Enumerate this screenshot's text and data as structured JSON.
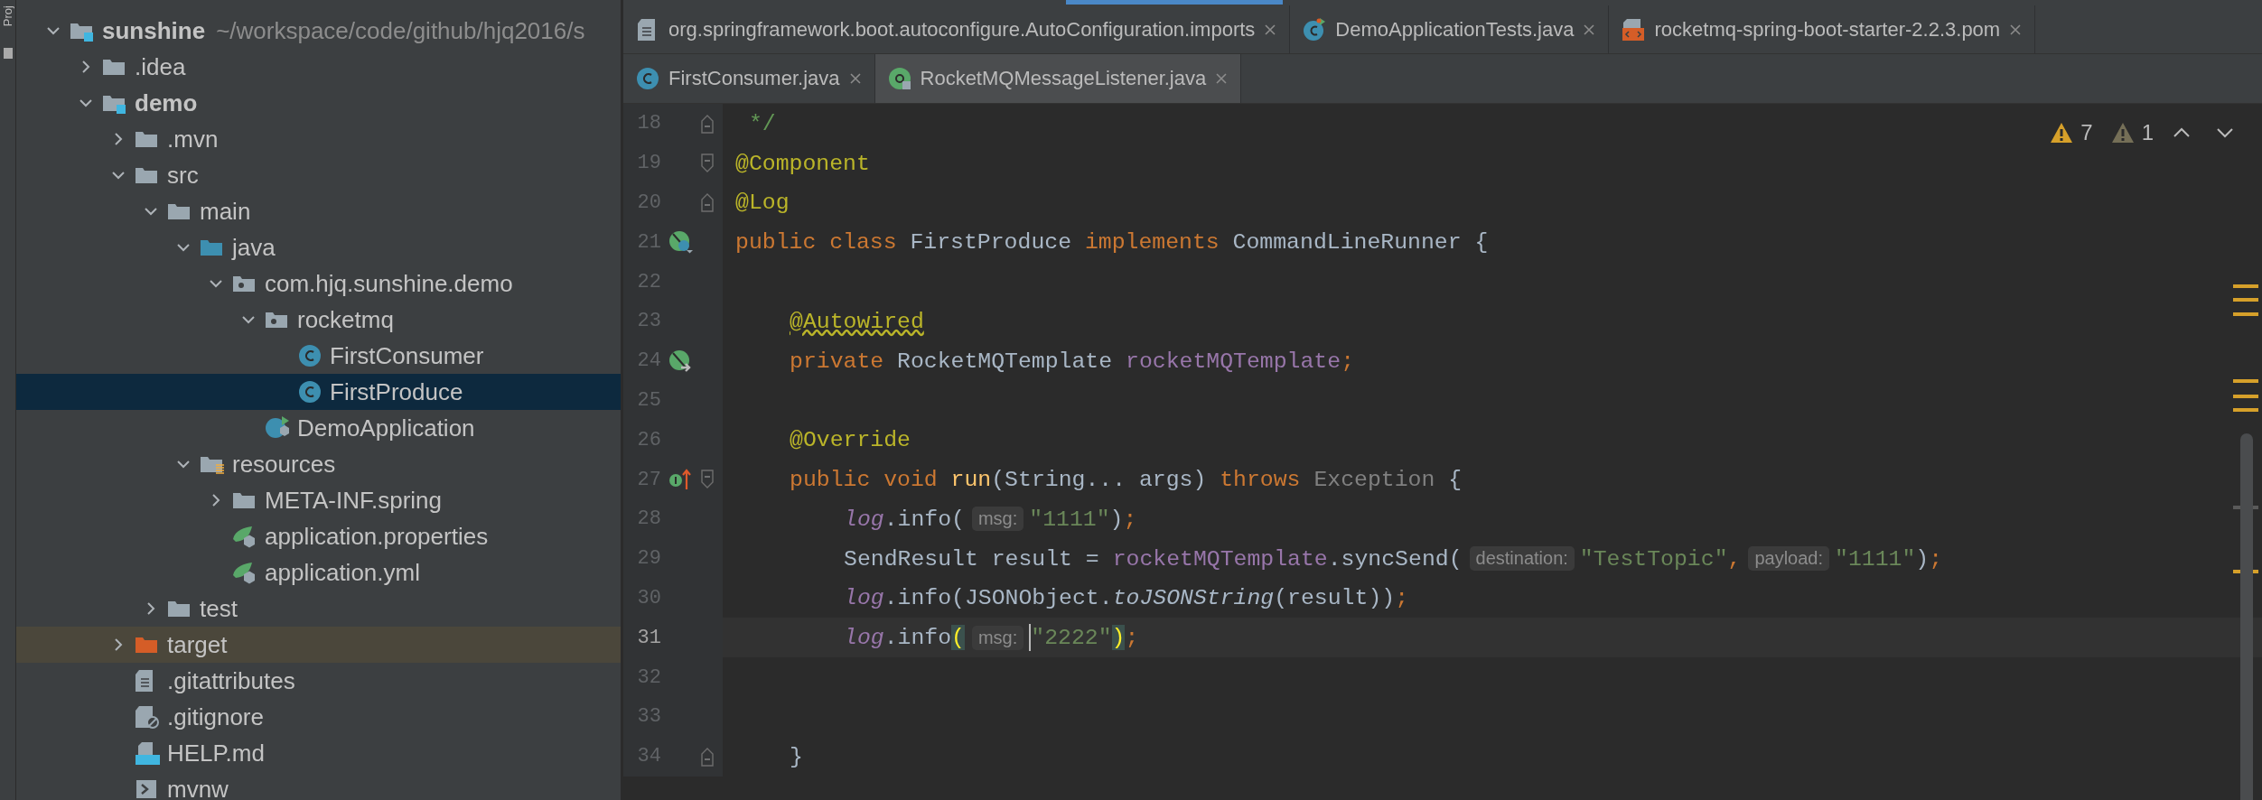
{
  "tool_window_strip": {
    "label": "Proj"
  },
  "tree": {
    "items": [
      {
        "label": "sunshine",
        "kind": "module",
        "path": "~/workspace/code/github/hjq2016/s",
        "expanded": true,
        "selected": false,
        "children": [
          {
            "label": ".idea",
            "kind": "folder",
            "expanded": false,
            "selected": false
          },
          {
            "label": "demo",
            "kind": "module",
            "expanded": true,
            "selected": false,
            "children": [
              {
                "label": ".mvn",
                "kind": "folder",
                "expanded": false,
                "selected": false
              },
              {
                "label": "src",
                "kind": "folder",
                "expanded": true,
                "selected": false,
                "children": [
                  {
                    "label": "main",
                    "kind": "folder",
                    "expanded": true,
                    "selected": false,
                    "children": [
                      {
                        "label": "java",
                        "kind": "source-folder",
                        "expanded": true,
                        "selected": false,
                        "children": [
                          {
                            "label": "com.hjq.sunshine.demo",
                            "kind": "package",
                            "expanded": true,
                            "selected": false,
                            "children": [
                              {
                                "label": "rocketmq",
                                "kind": "package",
                                "expanded": true,
                                "selected": false,
                                "children": [
                                  {
                                    "label": "FirstConsumer",
                                    "kind": "class",
                                    "selected": false
                                  },
                                  {
                                    "label": "FirstProduce",
                                    "kind": "class",
                                    "selected": true
                                  }
                                ]
                              },
                              {
                                "label": "DemoApplication",
                                "kind": "spring-class",
                                "selected": false
                              }
                            ]
                          }
                        ]
                      },
                      {
                        "label": "resources",
                        "kind": "resources-folder",
                        "expanded": true,
                        "selected": false,
                        "children": [
                          {
                            "label": "META-INF.spring",
                            "kind": "folder",
                            "expanded": false,
                            "selected": false
                          },
                          {
                            "label": "application.properties",
                            "kind": "spring-config",
                            "selected": false
                          },
                          {
                            "label": "application.yml",
                            "kind": "spring-config",
                            "selected": false
                          }
                        ]
                      }
                    ]
                  },
                  {
                    "label": "test",
                    "kind": "folder",
                    "expanded": false,
                    "selected": false
                  }
                ]
              },
              {
                "label": "target",
                "kind": "excluded-folder",
                "expanded": false,
                "selected": false
              },
              {
                "label": ".gitattributes",
                "kind": "text-file",
                "selected": false
              },
              {
                "label": ".gitignore",
                "kind": "ignore-file",
                "selected": false
              },
              {
                "label": "HELP.md",
                "kind": "markdown",
                "selected": false
              },
              {
                "label": "mvnw",
                "kind": "shell",
                "selected": false
              }
            ]
          }
        ]
      }
    ]
  },
  "tab_rows": [
    {
      "tabs": [
        {
          "label": "org.springframework.boot.autoconfigure.AutoConfiguration.imports",
          "kind": "text-file",
          "library": false,
          "selected": false
        },
        {
          "label": "DemoApplicationTests.java",
          "kind": "test-class",
          "library": false,
          "selected": false
        },
        {
          "label": "rocketmq-spring-boot-starter-2.2.3.pom",
          "kind": "pom",
          "library": false,
          "selected": false
        }
      ]
    },
    {
      "tabs": [
        {
          "label": "FirstConsumer.java",
          "kind": "class",
          "library": false,
          "selected": false
        },
        {
          "label": "RocketMQMessageListener.java",
          "kind": "annotation",
          "library": true,
          "selected": false
        }
      ]
    }
  ],
  "inspections": {
    "warnings": "7",
    "weak_warnings": "1"
  },
  "code_lines": [
    {
      "number": "18",
      "kind": "top",
      "fold_marker": {
        "kind": "end"
      },
      "current": false,
      "tokens": [
        {
          "kind": "comment",
          "text": " */"
        }
      ]
    },
    {
      "number": "19",
      "kind": "top",
      "fold_marker": {
        "kind": "start"
      },
      "current": false,
      "tokens": [
        {
          "kind": "annotation",
          "text": "@Component"
        }
      ]
    },
    {
      "number": "20",
      "kind": "top",
      "fold_marker": {
        "kind": "end"
      },
      "current": false,
      "tokens": [
        {
          "kind": "annotation",
          "text": "@Log"
        }
      ]
    },
    {
      "number": "21",
      "kind": "top",
      "gutter_icon": {
        "kind": "bean"
      },
      "current": false,
      "tokens": [
        {
          "kind": "keyword",
          "text": "public class "
        },
        {
          "kind": "plain",
          "text": "FirstProduce "
        },
        {
          "kind": "keyword",
          "text": "implements "
        },
        {
          "kind": "plain",
          "text": "CommandLineRunner {"
        }
      ]
    },
    {
      "number": "22",
      "kind": "top",
      "current": false
    },
    {
      "number": "23",
      "kind": "class",
      "current": false,
      "tokens": [
        {
          "kind": "warn-annotation",
          "text": "@Autowired"
        }
      ]
    },
    {
      "number": "24",
      "kind": "class",
      "gutter_icon": {
        "kind": "autowired"
      },
      "current": false,
      "tokens": [
        {
          "kind": "keyword",
          "text": "private "
        },
        {
          "kind": "plain",
          "text": "RocketMQTemplate "
        },
        {
          "kind": "field",
          "text": "rocketMQTemplate"
        },
        {
          "kind": "punct",
          "text": ";"
        }
      ]
    },
    {
      "number": "25",
      "kind": "top",
      "current": false
    },
    {
      "number": "26",
      "kind": "class",
      "current": false,
      "tokens": [
        {
          "kind": "annotation",
          "text": "@Override"
        }
      ]
    },
    {
      "number": "27",
      "kind": "class",
      "fold_marker": {
        "kind": "start"
      },
      "gutter_icon": {
        "kind": "override"
      },
      "current": false,
      "tokens": [
        {
          "kind": "keyword",
          "text": "public void "
        },
        {
          "kind": "method",
          "text": "run"
        },
        {
          "kind": "plain",
          "text": "(String... args) "
        },
        {
          "kind": "keyword",
          "text": "throws "
        },
        {
          "kind": "muted",
          "text": "Exception"
        },
        {
          "kind": "plain",
          "text": " {"
        }
      ]
    },
    {
      "number": "28",
      "kind": "method",
      "current": false,
      "tokens": [
        {
          "kind": "field-italic",
          "text": "log"
        },
        {
          "kind": "plain",
          "text": ".info("
        },
        {
          "kind": "hint",
          "text": "msg:"
        },
        {
          "kind": "string",
          "text": "\"1111\""
        },
        {
          "kind": "plain",
          "text": ")"
        },
        {
          "kind": "punct",
          "text": ";"
        }
      ]
    },
    {
      "number": "29",
      "kind": "method",
      "current": false,
      "tokens": [
        {
          "kind": "plain",
          "text": "SendResult result = "
        },
        {
          "kind": "field",
          "text": "rocketMQTemplate"
        },
        {
          "kind": "plain",
          "text": ".syncSend("
        },
        {
          "kind": "hint",
          "text": "destination:"
        },
        {
          "kind": "string",
          "text": "\"TestTopic\""
        },
        {
          "kind": "punct",
          "text": ","
        },
        {
          "kind": "hint",
          "text": "payload:"
        },
        {
          "kind": "string",
          "text": "\"1111\""
        },
        {
          "kind": "plain",
          "text": ")"
        },
        {
          "kind": "punct",
          "text": ";"
        }
      ]
    },
    {
      "number": "30",
      "kind": "method",
      "current": false,
      "tokens": [
        {
          "kind": "field-italic",
          "text": "log"
        },
        {
          "kind": "plain",
          "text": ".info(JSONObject."
        },
        {
          "kind": "italic",
          "text": "toJSONString"
        },
        {
          "kind": "plain",
          "text": "(result))"
        },
        {
          "kind": "punct",
          "text": ";"
        }
      ]
    },
    {
      "number": "31",
      "kind": "method",
      "current": true,
      "tokens": [
        {
          "kind": "field-italic",
          "text": "log"
        },
        {
          "kind": "plain",
          "text": ".info"
        },
        {
          "kind": "bracket",
          "text": "("
        },
        {
          "kind": "hint",
          "text": "msg:"
        },
        {
          "kind": "string",
          "text": "\"2222\"",
          "caret_before": true
        },
        {
          "kind": "bracket",
          "text": ")"
        },
        {
          "kind": "punct",
          "text": ";"
        }
      ]
    },
    {
      "number": "32",
      "kind": "top",
      "current": false
    },
    {
      "number": "33",
      "kind": "top",
      "current": false
    },
    {
      "number": "34",
      "kind": "class",
      "fold_marker": {
        "kind": "end"
      },
      "current": false,
      "tokens": [
        {
          "kind": "plain",
          "text": "}"
        }
      ]
    }
  ]
}
